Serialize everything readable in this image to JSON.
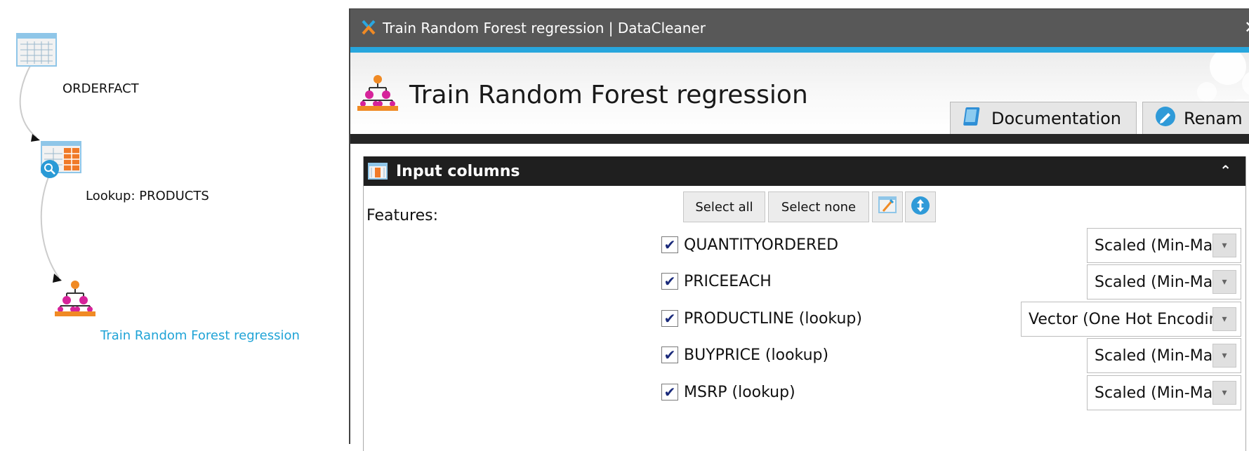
{
  "graph": {
    "nodes": [
      {
        "label": "ORDERFACT",
        "icon": "table-icon"
      },
      {
        "label": "Lookup: PRODUCTS",
        "icon": "table-lookup-icon"
      },
      {
        "label": "Train Random Forest regression",
        "icon": "random-forest-icon"
      }
    ]
  },
  "window": {
    "title": "Train Random Forest regression | DataCleaner",
    "close_glyph": "✕"
  },
  "header": {
    "title": "Train Random Forest regression",
    "buttons": [
      {
        "label": "Documentation",
        "icon": "book-icon"
      },
      {
        "label": "Renam",
        "icon": "pencil-icon"
      }
    ]
  },
  "panel": {
    "title": "Input columns",
    "collapse_glyph": "⌃",
    "features_label": "Features:",
    "select_all": "Select all",
    "select_none": "Select none",
    "rows": [
      {
        "name": "QUANTITYORDERED",
        "checked": true,
        "scaling": "Scaled (Min-Max)"
      },
      {
        "name": "PRICEEACH",
        "checked": true,
        "scaling": "Scaled (Min-Max)"
      },
      {
        "name": "PRODUCTLINE (lookup)",
        "checked": true,
        "scaling": "Vector (One Hot Encoding)"
      },
      {
        "name": "BUYPRICE (lookup)",
        "checked": true,
        "scaling": "Scaled (Min-Max)"
      },
      {
        "name": "MSRP (lookup)",
        "checked": true,
        "scaling": "Scaled (Min-Max)"
      }
    ]
  },
  "colors": {
    "accent": "#27a6dd",
    "titlebar": "#585858",
    "panel_header": "#1f1f1f",
    "active_node_label": "#1fa3d6",
    "node_orange": "#f08a24",
    "node_magenta": "#d6239a"
  }
}
